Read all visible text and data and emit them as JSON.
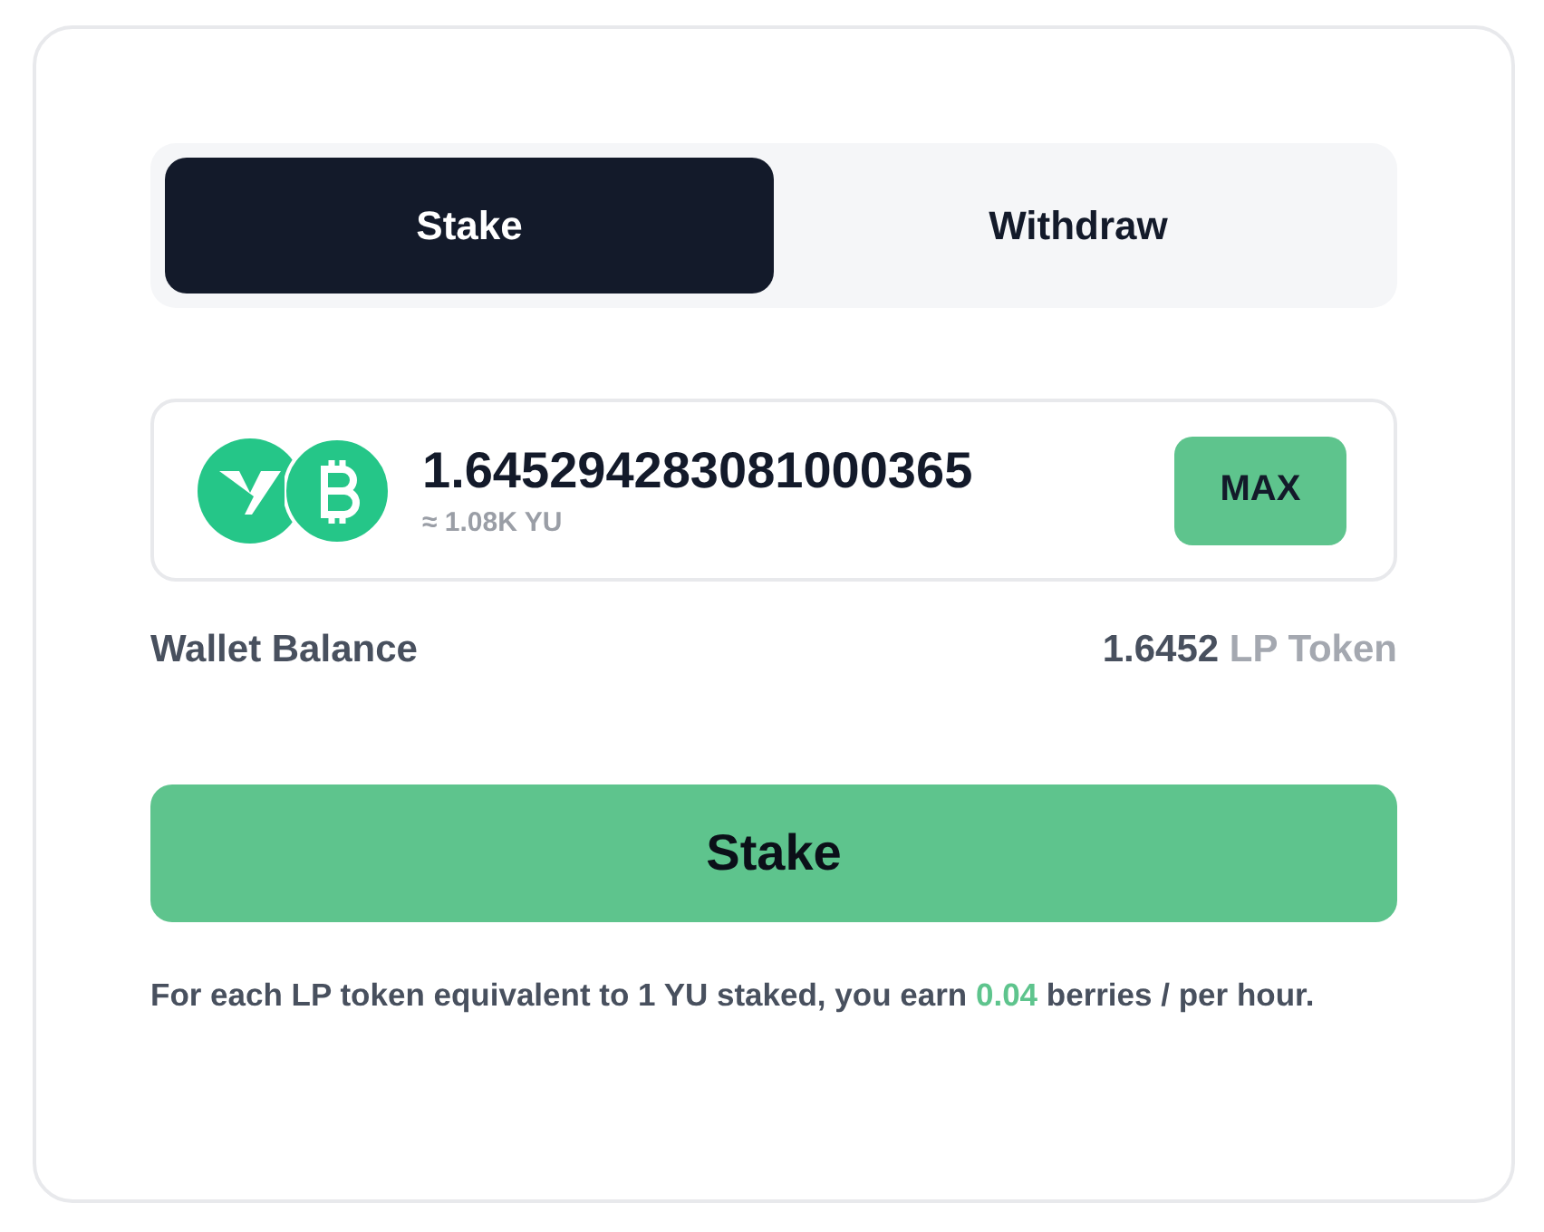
{
  "tabs": [
    {
      "label": "Stake",
      "selected": true
    },
    {
      "label": "Withdraw",
      "selected": false
    }
  ],
  "amount": {
    "value": "1.645294283081000365",
    "estimate": "≈ 1.08K YU",
    "max_button": "MAX"
  },
  "wallet": {
    "label": "Wallet Balance",
    "value": "1.6452",
    "unit": "LP Token"
  },
  "submit_button": "Stake",
  "note": {
    "before": "For each LP token equivalent to 1 YU staked, you earn ",
    "highlight": "0.04",
    "after": " berries / per hour."
  }
}
